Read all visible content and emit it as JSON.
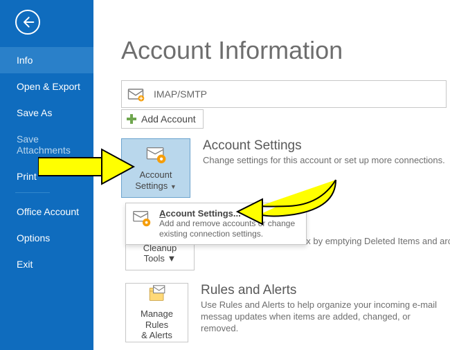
{
  "colors": {
    "brand": "#0f6cbe",
    "brand_light": "#2a80c9"
  },
  "sidebar": {
    "items": {
      "info": "Info",
      "open_export": "Open & Export",
      "save_as": "Save As",
      "save_attachments": "Save Attachments",
      "print": "Print",
      "office_account": "Office Account",
      "options": "Options",
      "exit": "Exit"
    }
  },
  "header": {
    "title": "Account Information"
  },
  "account": {
    "type": "IMAP/SMTP",
    "add_label": "Add Account"
  },
  "account_settings": {
    "button_line1": "Account",
    "button_line2": "Settings",
    "title": "Account Settings",
    "desc": "Change settings for this account or set up more connections.",
    "dropdown_title": "Account Settings...",
    "dropdown_desc": "Add and remove accounts or change existing connection settings."
  },
  "mailbox": {
    "button_line1": "Cleanup",
    "button_line2": "Tools",
    "desc_fragment": "ilbox by emptying Deleted Items and arc"
  },
  "rules": {
    "button_line1": "Manage Rules",
    "button_line2": "& Alerts",
    "title": "Rules and Alerts",
    "desc": "Use Rules and Alerts to help organize your incoming e-mail messag updates when items are added, changed, or removed."
  }
}
